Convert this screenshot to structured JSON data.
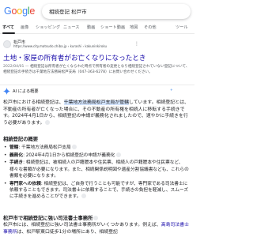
{
  "logo": [
    "G",
    "o",
    "o",
    "g",
    "l",
    "e"
  ],
  "logo_colors": [
    "#4285f4",
    "#ea4335",
    "#fbbc05",
    "#4285f4",
    "#34a853",
    "#ea4335"
  ],
  "search": {
    "query": "相続登記 松戸市"
  },
  "tabs": [
    "すべて",
    "画像",
    "ショッピング",
    "ニュース",
    "動画",
    "ショート動画",
    "地図",
    "その他",
    "ツール"
  ],
  "result": {
    "site_name": "松戸市",
    "url": "https://www.city.matsudo.chiba.jp › kurashi › kakuninkiroku",
    "title": "土地・家屋の所有者がお亡くなりになったとき",
    "date": "2022/04/01 —",
    "snippet": "相続登記は所有者が亡くなられた時点で所有者の変更となり相続登記されていない登記について、相続登記の手続きは千葉地方法務局松戸支局（047-363-6278）にお問い合わせください。"
  },
  "ai": {
    "title": "AI による概要",
    "more": "もっと見る",
    "intro_pre": "松戸市における相続登記は、",
    "intro_hl": "千葉地方法務局松戸支局が管轄",
    "intro_post": "しています。相続登記とは、不動産の所有者が亡くなった場合に、その不動産の所有権を相続人に移転する手続きです。2024年4月1日から、相続登記の申請が義務化されましたので、速やかに手続きを行う必要があります。",
    "summary_head": "相続登記の概要",
    "bullets": [
      {
        "label": "管轄",
        "text": ": 千葉地方法務局松戸支局"
      },
      {
        "label": "義務化",
        "text": ": 2024年4月1日から相続登記の申請が義務化"
      },
      {
        "label": "手続き",
        "text": ": 相続登記は、被相続人の戸籍謄本や住民票、相続人の戸籍謄本や住民票など、様々な書類が必要になります。また、相続関係説明図や遺産分割協議書なども、これらの書類を必要になります。"
      },
      {
        "label": "専門家への依頼",
        "text": ": 相続登記は、ご自身で行うことも可能ですが、専門家である司法書士に依頼することもできます。司法書士に依頼することで、手続きの負担を軽減し、スムーズに手続きを進めることができます。"
      }
    ],
    "office_head": "松戸市で相続登記に強い司法書士事務所",
    "office_pre": "松戸市には、相続登記に強い司法書士事務所がいくつかあります。例えば、",
    "office_link": "高島司法書士事務所",
    "office_post": "は、松戸駅東口徒歩1分の場所にあり、相続登記"
  }
}
